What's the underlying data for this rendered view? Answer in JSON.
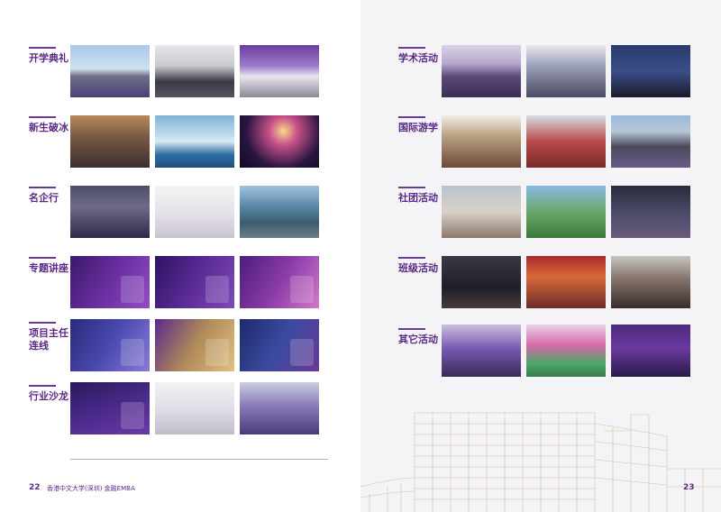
{
  "left_page": {
    "categories": [
      {
        "label": "开学典礼"
      },
      {
        "label": "新生破冰"
      },
      {
        "label": "名企行"
      },
      {
        "label": "专题讲座"
      },
      {
        "label": "项目主任\n连线"
      },
      {
        "label": "行业沙龙"
      }
    ],
    "page_number": "22",
    "footer_text": "香港中文大学(深圳) 金融EMBA"
  },
  "right_page": {
    "categories": [
      {
        "label": "学术活动"
      },
      {
        "label": "国际游学"
      },
      {
        "label": "社团活动"
      },
      {
        "label": "班级活动"
      },
      {
        "label": "其它活动"
      }
    ],
    "page_number": "23"
  }
}
